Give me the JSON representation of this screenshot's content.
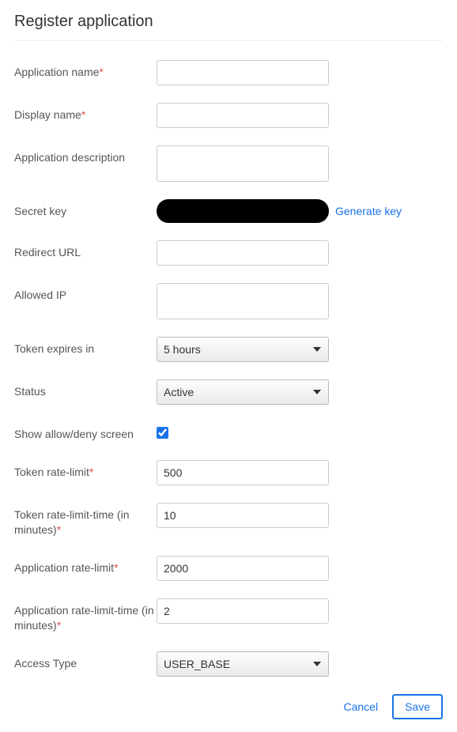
{
  "header": {
    "title": "Register application"
  },
  "form": {
    "application_name": {
      "label": "Application name",
      "required": true,
      "value": ""
    },
    "display_name": {
      "label": "Display name",
      "required": true,
      "value": ""
    },
    "application_description": {
      "label": "Application description",
      "required": false,
      "value": ""
    },
    "secret_key": {
      "label": "Secret key",
      "generate_link": "Generate key"
    },
    "redirect_url": {
      "label": "Redirect URL",
      "value": ""
    },
    "allowed_ip": {
      "label": "Allowed IP",
      "value": ""
    },
    "token_expires": {
      "label": "Token expires in",
      "selected": "5 hours"
    },
    "status": {
      "label": "Status",
      "selected": "Active"
    },
    "show_allow_deny": {
      "label": "Show allow/deny screen",
      "checked": true
    },
    "token_rate_limit": {
      "label": "Token rate-limit",
      "required": true,
      "value": "500"
    },
    "token_rate_limit_time": {
      "label": "Token rate-limit-time (in minutes)",
      "required": true,
      "value": "10"
    },
    "application_rate_limit": {
      "label": "Application rate-limit",
      "required": true,
      "value": "2000"
    },
    "application_rate_limit_time": {
      "label": "Application rate-limit-time (in minutes)",
      "required": true,
      "value": "2"
    },
    "access_type": {
      "label": "Access Type",
      "selected": "USER_BASE"
    }
  },
  "footer": {
    "cancel_label": "Cancel",
    "save_label": "Save"
  }
}
